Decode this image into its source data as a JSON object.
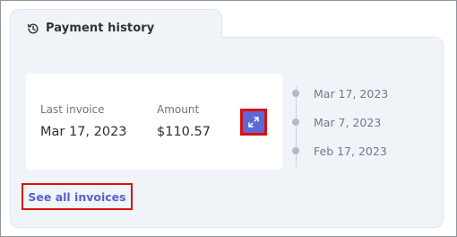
{
  "tab": {
    "title": "Payment history",
    "icon": "history-icon"
  },
  "invoice": {
    "last_invoice_label": "Last invoice",
    "last_invoice_value": "Mar 17, 2023",
    "amount_label": "Amount",
    "amount_value": "$110.57",
    "expand_icon": "expand-icon"
  },
  "timeline": {
    "items": [
      "Mar 17, 2023",
      "Mar 7, 2023",
      "Feb 17, 2023"
    ]
  },
  "links": {
    "see_all": "See all invoices"
  },
  "colors": {
    "accent": "#5e68d8",
    "link": "#5563cf",
    "highlight": "#da1010",
    "panel_bg": "#f0f4f8"
  }
}
